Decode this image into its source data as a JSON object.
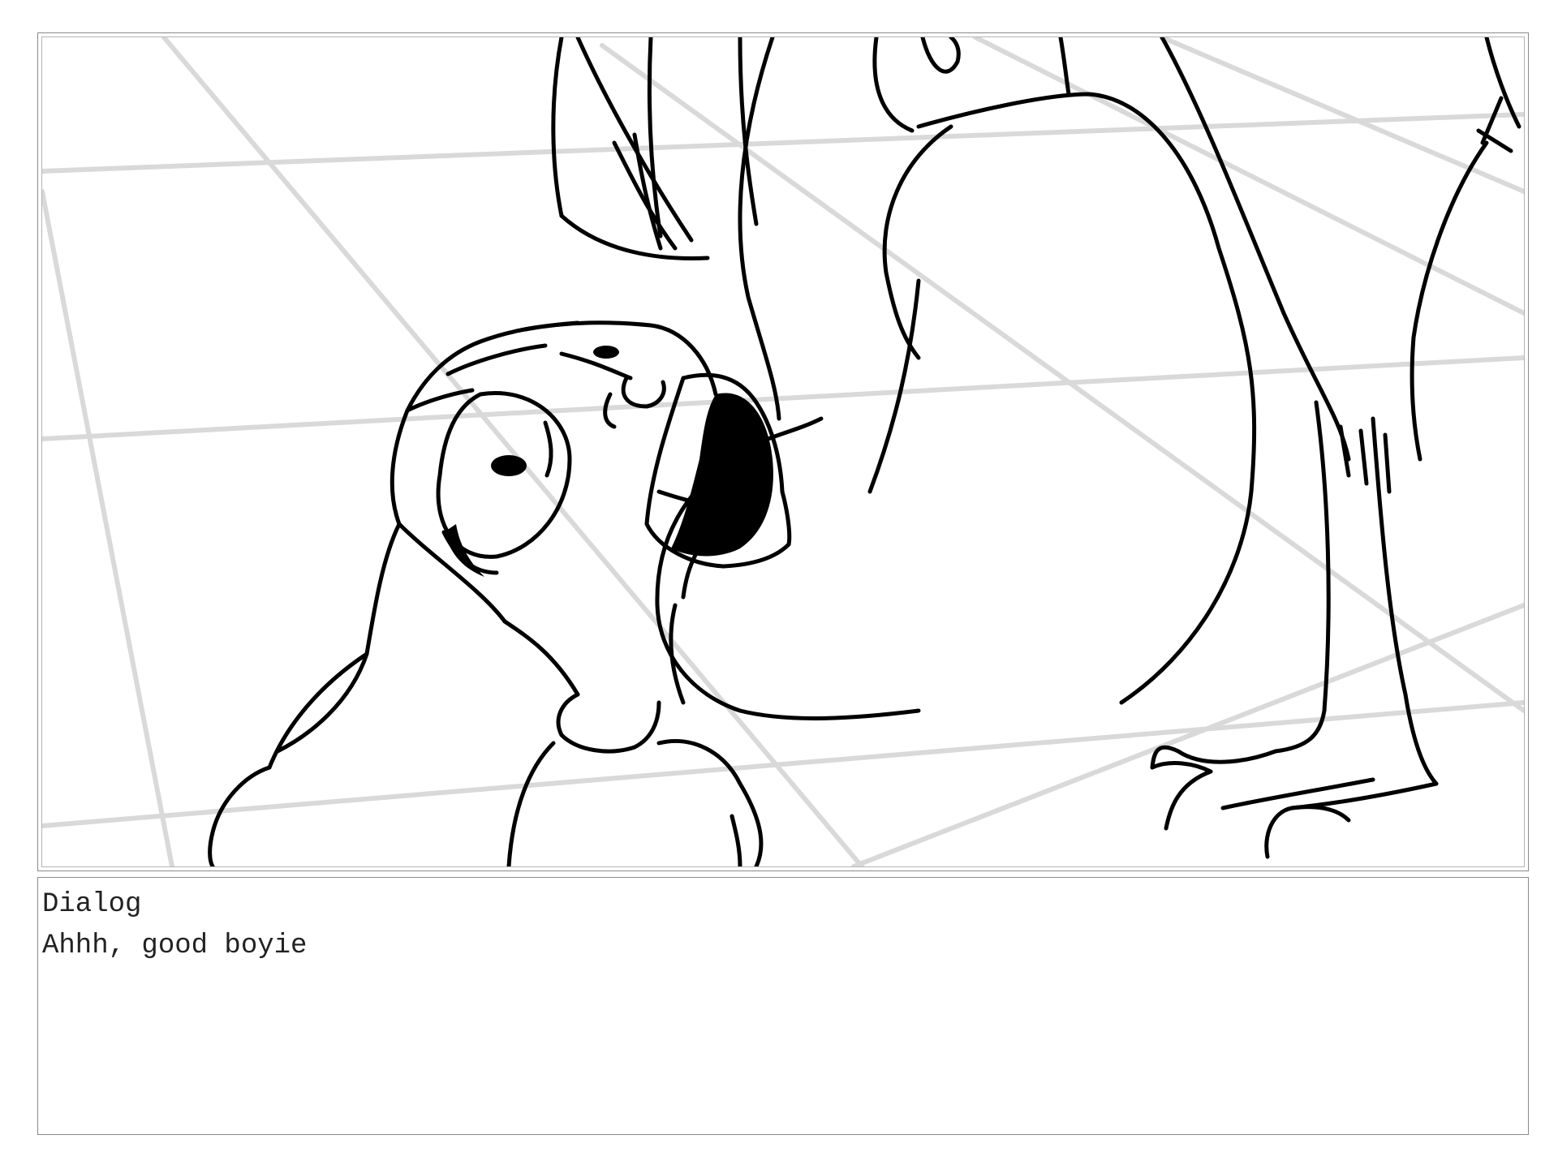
{
  "dialog": {
    "heading": "Dialog",
    "line": "Ahhh, good boyie"
  },
  "panel": {
    "icon": "storyboard-sketch",
    "grid_color": "#d9d9d9",
    "ink_color": "#000000",
    "frame_color": "#8a8a8a"
  }
}
